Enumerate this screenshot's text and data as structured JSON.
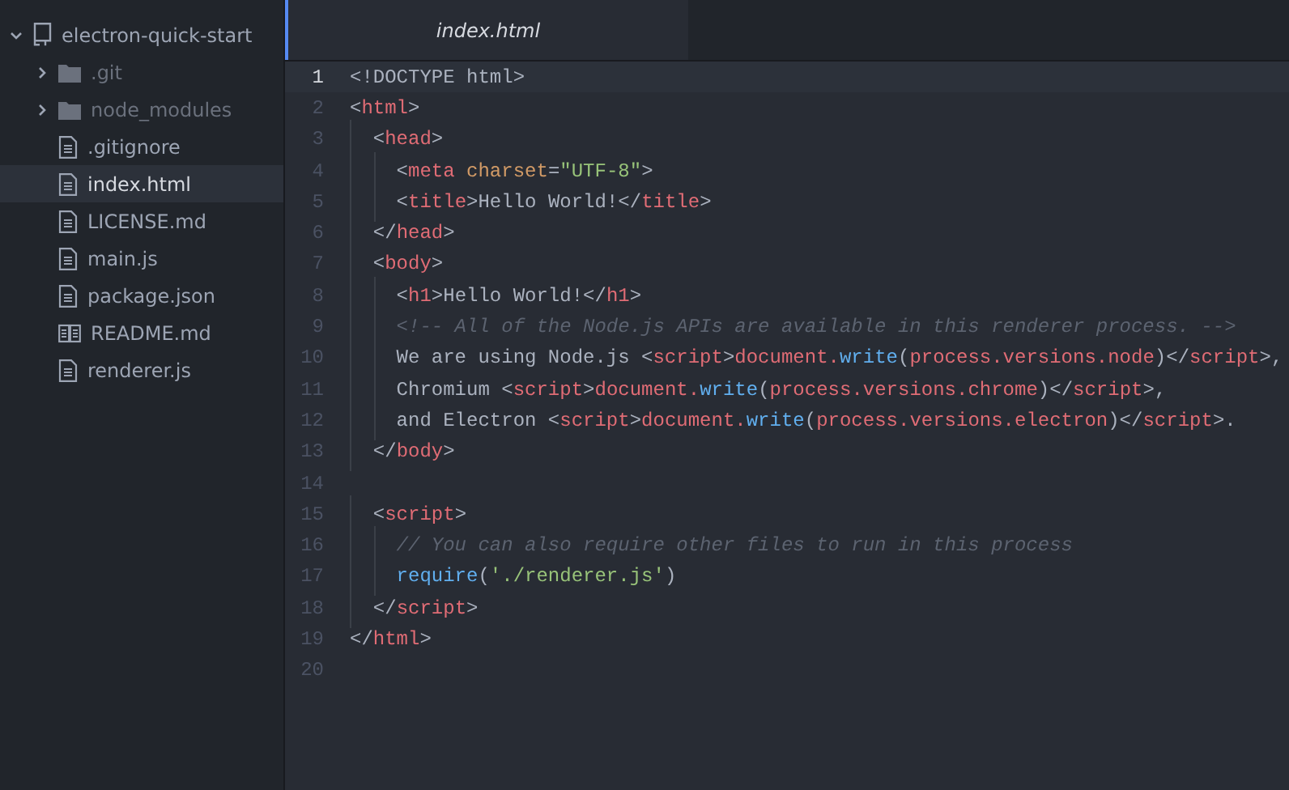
{
  "tree": {
    "root": {
      "label": "electron-quick-start",
      "expanded": true
    },
    "items": [
      {
        "kind": "folder",
        "label": ".git",
        "expanded": false,
        "selected": false
      },
      {
        "kind": "folder",
        "label": "node_modules",
        "expanded": false,
        "selected": false
      },
      {
        "kind": "file",
        "label": ".gitignore",
        "selected": false
      },
      {
        "kind": "file",
        "label": "index.html",
        "selected": true
      },
      {
        "kind": "file",
        "label": "LICENSE.md",
        "selected": false
      },
      {
        "kind": "file",
        "label": "main.js",
        "selected": false
      },
      {
        "kind": "file",
        "label": "package.json",
        "selected": false
      },
      {
        "kind": "book",
        "label": "README.md",
        "selected": false
      },
      {
        "kind": "file",
        "label": "renderer.js",
        "selected": false
      }
    ]
  },
  "tabs": [
    {
      "label": "index.html",
      "selected": true
    }
  ],
  "editor": {
    "lines": [
      {
        "number": "1",
        "current": true,
        "tokens": [
          {
            "kind": "punct",
            "text": "<!DOCTYPE html>"
          }
        ]
      },
      {
        "number": "2",
        "current": false,
        "tokens": [
          {
            "kind": "punct",
            "text": "<"
          },
          {
            "kind": "tag",
            "text": "html"
          },
          {
            "kind": "punct",
            "text": ">"
          }
        ]
      },
      {
        "number": "3",
        "current": false,
        "tokens": [
          {
            "kind": "punct",
            "text": "  <"
          },
          {
            "kind": "tag",
            "text": "head"
          },
          {
            "kind": "punct",
            "text": ">"
          }
        ]
      },
      {
        "number": "4",
        "current": false,
        "tokens": [
          {
            "kind": "punct",
            "text": "    <"
          },
          {
            "kind": "tag",
            "text": "meta "
          },
          {
            "kind": "attr",
            "text": "charset"
          },
          {
            "kind": "punct",
            "text": "="
          },
          {
            "kind": "string",
            "text": "\"UTF-8\""
          },
          {
            "kind": "punct",
            "text": ">"
          }
        ]
      },
      {
        "number": "5",
        "current": false,
        "tokens": [
          {
            "kind": "punct",
            "text": "    <"
          },
          {
            "kind": "tag",
            "text": "title"
          },
          {
            "kind": "punct",
            "text": ">Hello World!</"
          },
          {
            "kind": "tag",
            "text": "title"
          },
          {
            "kind": "punct",
            "text": ">"
          }
        ]
      },
      {
        "number": "6",
        "current": false,
        "tokens": [
          {
            "kind": "punct",
            "text": "  </"
          },
          {
            "kind": "tag",
            "text": "head"
          },
          {
            "kind": "punct",
            "text": ">"
          }
        ]
      },
      {
        "number": "7",
        "current": false,
        "tokens": [
          {
            "kind": "punct",
            "text": "  <"
          },
          {
            "kind": "tag",
            "text": "body"
          },
          {
            "kind": "punct",
            "text": ">"
          }
        ]
      },
      {
        "number": "8",
        "current": false,
        "tokens": [
          {
            "kind": "punct",
            "text": "    <"
          },
          {
            "kind": "tag",
            "text": "h1"
          },
          {
            "kind": "punct",
            "text": ">Hello World!</"
          },
          {
            "kind": "tag",
            "text": "h1"
          },
          {
            "kind": "punct",
            "text": ">"
          }
        ]
      },
      {
        "number": "9",
        "current": false,
        "tokens": [
          {
            "kind": "comment",
            "text": "    <!-- All of the Node.js APIs are available in this renderer process. -->"
          }
        ]
      },
      {
        "number": "10",
        "current": false,
        "tokens": [
          {
            "kind": "punct",
            "text": "    We are using Node.js <"
          },
          {
            "kind": "tag",
            "text": "script"
          },
          {
            "kind": "punct",
            "text": ">"
          },
          {
            "kind": "tag",
            "text": "document."
          },
          {
            "kind": "func",
            "text": "write"
          },
          {
            "kind": "punct",
            "text": "("
          },
          {
            "kind": "tag",
            "text": "process.versions.node"
          },
          {
            "kind": "punct",
            "text": ")</"
          },
          {
            "kind": "tag",
            "text": "script"
          },
          {
            "kind": "punct",
            "text": ">,"
          }
        ]
      },
      {
        "number": "11",
        "current": false,
        "tokens": [
          {
            "kind": "punct",
            "text": "    Chromium <"
          },
          {
            "kind": "tag",
            "text": "script"
          },
          {
            "kind": "punct",
            "text": ">"
          },
          {
            "kind": "tag",
            "text": "document."
          },
          {
            "kind": "func",
            "text": "write"
          },
          {
            "kind": "punct",
            "text": "("
          },
          {
            "kind": "tag",
            "text": "process.versions.chrome"
          },
          {
            "kind": "punct",
            "text": ")</"
          },
          {
            "kind": "tag",
            "text": "script"
          },
          {
            "kind": "punct",
            "text": ">,"
          }
        ]
      },
      {
        "number": "12",
        "current": false,
        "tokens": [
          {
            "kind": "punct",
            "text": "    and Electron <"
          },
          {
            "kind": "tag",
            "text": "script"
          },
          {
            "kind": "punct",
            "text": ">"
          },
          {
            "kind": "tag",
            "text": "document."
          },
          {
            "kind": "func",
            "text": "write"
          },
          {
            "kind": "punct",
            "text": "("
          },
          {
            "kind": "tag",
            "text": "process.versions.electron"
          },
          {
            "kind": "punct",
            "text": ")</"
          },
          {
            "kind": "tag",
            "text": "script"
          },
          {
            "kind": "punct",
            "text": ">."
          }
        ]
      },
      {
        "number": "13",
        "current": false,
        "tokens": [
          {
            "kind": "punct",
            "text": "  </"
          },
          {
            "kind": "tag",
            "text": "body"
          },
          {
            "kind": "punct",
            "text": ">"
          }
        ]
      },
      {
        "number": "14",
        "current": false
      },
      {
        "number": "15",
        "current": false,
        "tokens": [
          {
            "kind": "punct",
            "text": "  <"
          },
          {
            "kind": "tag",
            "text": "script"
          },
          {
            "kind": "punct",
            "text": ">"
          }
        ]
      },
      {
        "number": "16",
        "current": false,
        "tokens": [
          {
            "kind": "comment",
            "text": "    // You can also require other files to run in this process"
          }
        ]
      },
      {
        "number": "17",
        "current": false,
        "tokens": [
          {
            "kind": "func",
            "text": "    require"
          },
          {
            "kind": "punct",
            "text": "("
          },
          {
            "kind": "string",
            "text": "'./renderer.js'"
          },
          {
            "kind": "punct",
            "text": ")"
          }
        ]
      },
      {
        "number": "18",
        "current": false,
        "tokens": [
          {
            "kind": "punct",
            "text": "  </"
          },
          {
            "kind": "tag",
            "text": "script"
          },
          {
            "kind": "punct",
            "text": ">"
          }
        ]
      },
      {
        "number": "19",
        "current": false,
        "tokens": [
          {
            "kind": "punct",
            "text": "</"
          },
          {
            "kind": "tag",
            "text": "html"
          },
          {
            "kind": "punct",
            "text": ">"
          }
        ]
      },
      {
        "number": "20",
        "current": false
      }
    ]
  }
}
